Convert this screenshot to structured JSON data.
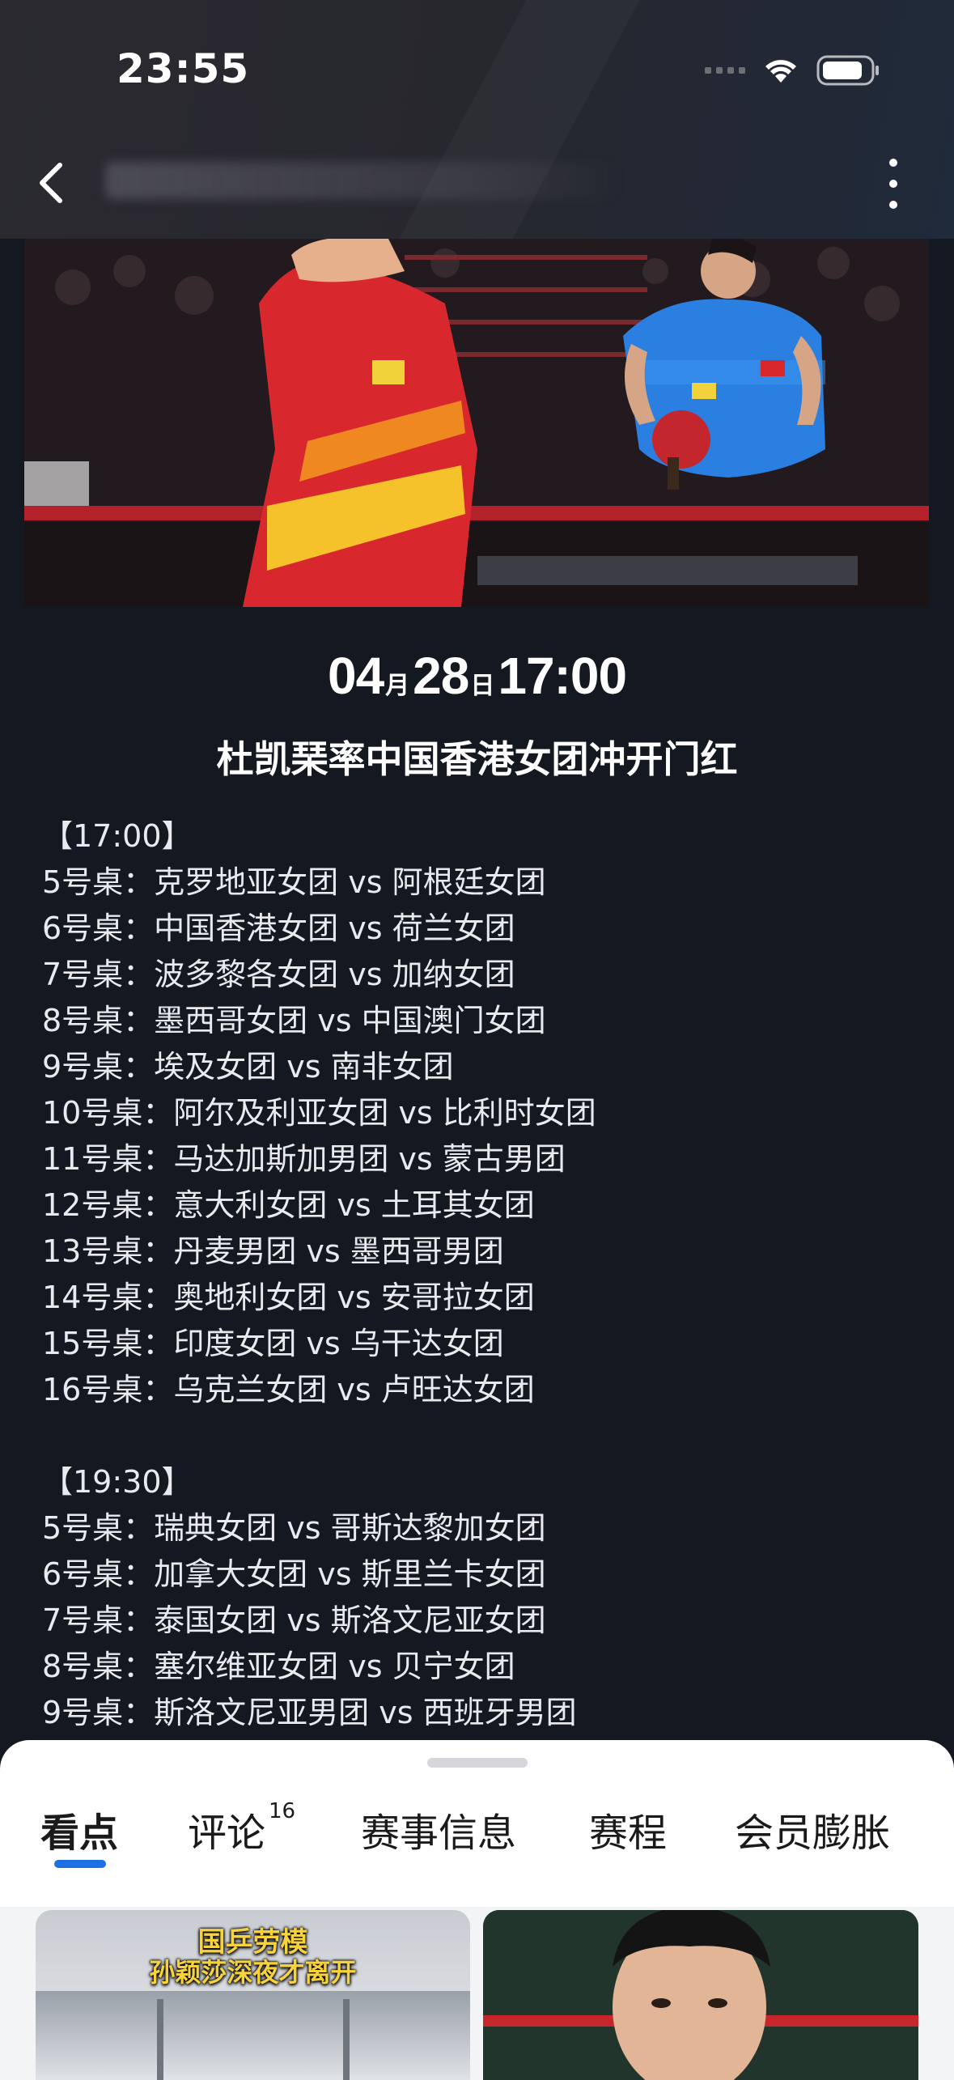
{
  "status_bar": {
    "time": "23:55"
  },
  "match": {
    "date_month": "04",
    "month_unit": "月",
    "date_day": "28",
    "day_unit": "日",
    "time": "17:00",
    "title": "杜凯琹率中国香港女团冲开门红"
  },
  "schedule": {
    "sessions": [
      {
        "time_label": "【17:00】",
        "lines": [
          "5号桌：克罗地亚女团 vs 阿根廷女团",
          "6号桌：中国香港女团 vs 荷兰女团",
          "7号桌：波多黎各女团 vs 加纳女团",
          "8号桌：墨西哥女团 vs 中国澳门女团",
          "9号桌：埃及女团 vs 南非女团",
          "10号桌：阿尔及利亚女团 vs 比利时女团",
          "11号桌：马达加斯加男团 vs 蒙古男团",
          "12号桌：意大利女团 vs 土耳其女团",
          "13号桌：丹麦男团 vs 墨西哥男团",
          "14号桌：奥地利女团 vs 安哥拉女团",
          "15号桌：印度女团 vs 乌干达女团",
          "16号桌：乌克兰女团 vs 卢旺达女团"
        ]
      },
      {
        "time_label": "【19:30】",
        "lines": [
          "5号桌：瑞典女团 vs 哥斯达黎加女团",
          "6号桌：加拿大女团 vs 斯里兰卡女团",
          "7号桌：泰国女团 vs 斯洛文尼亚女团",
          "8号桌：塞尔维亚女团 vs 贝宁女团",
          "9号桌：斯洛文尼亚男团 vs 西班牙男团"
        ]
      }
    ]
  },
  "tabs": [
    {
      "label": "看点",
      "active": true
    },
    {
      "label": "评论",
      "badge": "16"
    },
    {
      "label": "赛事信息"
    },
    {
      "label": "赛程"
    },
    {
      "label": "会员膨胀"
    }
  ],
  "cards": [
    {
      "caption_line1": "国乒劳模",
      "caption_line2": "孙颖莎深夜才离开"
    }
  ],
  "colors": {
    "page_bg": "#141821",
    "accent": "#1f6fe5",
    "caption": "#f6d33e"
  }
}
